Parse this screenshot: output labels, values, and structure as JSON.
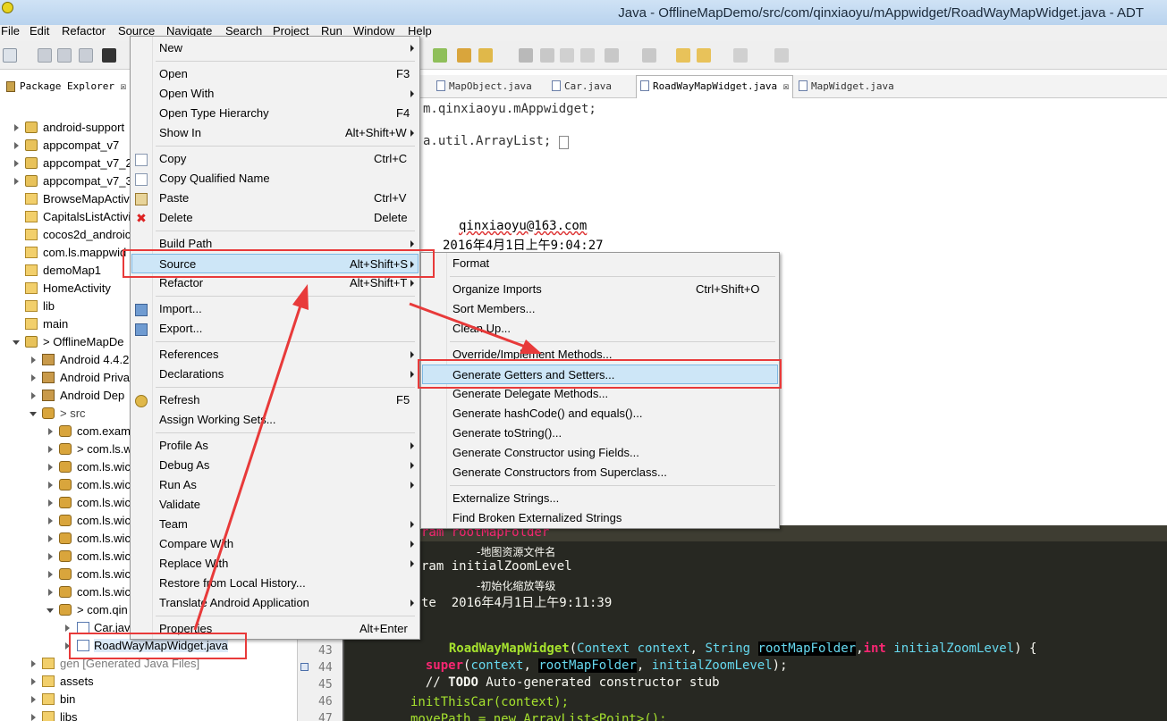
{
  "window": {
    "title": "Java - OfflineMapDemo/src/com/qinxiaoyu/mAppwidget/RoadWayMapWidget.java - ADT"
  },
  "menubar": [
    "File",
    "Edit",
    "Refactor",
    "Source",
    "Navigate",
    "Search",
    "Project",
    "Run",
    "Window",
    "Help"
  ],
  "package_explorer": {
    "title": "Package Explorer ☒",
    "items": [
      "android-support",
      "appcompat_v7",
      "appcompat_v7_2",
      "appcompat_v7_3",
      "BrowseMapActiv",
      "CapitalsListActivi",
      "cocos2d_androic",
      "com.ls.mappwid",
      "demoMap1",
      "HomeActivity",
      "lib",
      "main",
      "> OfflineMapDe",
      "Android 4.4.2",
      "Android Priva",
      "Android Dep",
      "> src",
      "com.exam",
      "> com.ls.w",
      "com.ls.wic",
      "com.ls.wic",
      "com.ls.wic",
      "com.ls.wic",
      "com.ls.wic",
      "com.ls.wic",
      "com.ls.wic",
      "com.ls.wic",
      "> com.qin",
      "Car.jav",
      "RoadWayMapWidget.java",
      "gen [Generated Java Files]",
      "assets",
      "bin",
      "libs"
    ]
  },
  "editor_tabs": [
    "MapObject.java",
    "Car.java",
    "RoadWayMapWidget.java ☒",
    "MapWidget.java"
  ],
  "code_top": [
    {
      "text": "m.qinxiaoyu.mAppwidget;"
    },
    {
      "text": "a.util.ArrayList;"
    },
    {
      "text": "qinxiaoyu@163.com"
    },
    {
      "text": "2016年4月1日上午9:04:27"
    }
  ],
  "code_bottom": {
    "line_numbers": [
      "43",
      "44",
      "45",
      "46",
      "47"
    ],
    "param1": "ram rootMapFolder",
    "param1_note": "-地图资源文件名",
    "param2": "ram initialZoomLevel",
    "param2_note": "-初始化缩放等级",
    "date": "te  2016年4月1日上午9:11:39",
    "constructor": {
      "name": "RoadWayMapWidget",
      "open": "(",
      "t1": "Context",
      "a1": "context",
      "c1": ",",
      "t2": "String",
      "a2": "rootMapFolder",
      "c2": ",",
      "kw": "int",
      "a3": "initialZoomLevel",
      "close": ") {"
    },
    "super": {
      "kw": "super",
      "open": "(",
      "a1": "context",
      "c1": ",",
      "a2": "rootMapFolder",
      "c2": ",",
      "a3": "initialZoomLevel",
      "close": ");"
    },
    "todo": {
      "prefix": "// ",
      "tag": "TODO",
      "rest": " Auto-generated constructor stub"
    },
    "init": "initThisCar(context);",
    "move": "movePath = new ArrayList<Point>();"
  },
  "context_menu": {
    "items": [
      {
        "label": "New",
        "shortcut": "",
        "sub": true
      },
      {
        "label": "Open",
        "shortcut": "F3"
      },
      {
        "label": "Open With",
        "shortcut": "",
        "sub": true
      },
      {
        "label": "Open Type Hierarchy",
        "shortcut": "F4"
      },
      {
        "label": "Show In",
        "shortcut": "Alt+Shift+W",
        "sub": true
      },
      {
        "label": "Copy",
        "shortcut": "Ctrl+C"
      },
      {
        "label": "Copy Qualified Name",
        "shortcut": ""
      },
      {
        "label": "Paste",
        "shortcut": "Ctrl+V"
      },
      {
        "label": "Delete",
        "shortcut": "Delete"
      },
      {
        "label": "Build Path",
        "shortcut": "",
        "sub": true
      },
      {
        "label": "Source",
        "shortcut": "Alt+Shift+S",
        "sub": true
      },
      {
        "label": "Refactor",
        "shortcut": "Alt+Shift+T",
        "sub": true
      },
      {
        "label": "Import...",
        "shortcut": ""
      },
      {
        "label": "Export...",
        "shortcut": ""
      },
      {
        "label": "References",
        "shortcut": "",
        "sub": true
      },
      {
        "label": "Declarations",
        "shortcut": "",
        "sub": true
      },
      {
        "label": "Refresh",
        "shortcut": "F5"
      },
      {
        "label": "Assign Working Sets...",
        "shortcut": ""
      },
      {
        "label": "Profile As",
        "shortcut": "",
        "sub": true
      },
      {
        "label": "Debug As",
        "shortcut": "",
        "sub": true
      },
      {
        "label": "Run As",
        "shortcut": "",
        "sub": true
      },
      {
        "label": "Validate",
        "shortcut": ""
      },
      {
        "label": "Team",
        "shortcut": "",
        "sub": true
      },
      {
        "label": "Compare With",
        "shortcut": "",
        "sub": true
      },
      {
        "label": "Replace With",
        "shortcut": "",
        "sub": true
      },
      {
        "label": "Restore from Local History...",
        "shortcut": ""
      },
      {
        "label": "Translate Android Application",
        "shortcut": "",
        "sub": true
      },
      {
        "label": "Properties",
        "shortcut": "Alt+Enter"
      }
    ]
  },
  "source_submenu": {
    "items": [
      {
        "label": "Format",
        "shortcut": ""
      },
      {
        "label": "Organize Imports",
        "shortcut": "Ctrl+Shift+O"
      },
      {
        "label": "Sort Members...",
        "shortcut": ""
      },
      {
        "label": "Clean Up...",
        "shortcut": ""
      },
      {
        "label": "Override/Implement Methods...",
        "shortcut": ""
      },
      {
        "label": "Generate Getters and Setters...",
        "shortcut": ""
      },
      {
        "label": "Generate Delegate Methods...",
        "shortcut": ""
      },
      {
        "label": "Generate hashCode() and equals()...",
        "shortcut": ""
      },
      {
        "label": "Generate toString()...",
        "shortcut": ""
      },
      {
        "label": "Generate Constructor using Fields...",
        "shortcut": ""
      },
      {
        "label": "Generate Constructors from Superclass...",
        "shortcut": ""
      },
      {
        "label": "Externalize Strings...",
        "shortcut": ""
      },
      {
        "label": "Find Broken Externalized Strings",
        "shortcut": ""
      }
    ]
  },
  "colors": {
    "annotation": "#e83a3a",
    "highlight": "#cde6f7",
    "editor_bg": "#272822"
  }
}
